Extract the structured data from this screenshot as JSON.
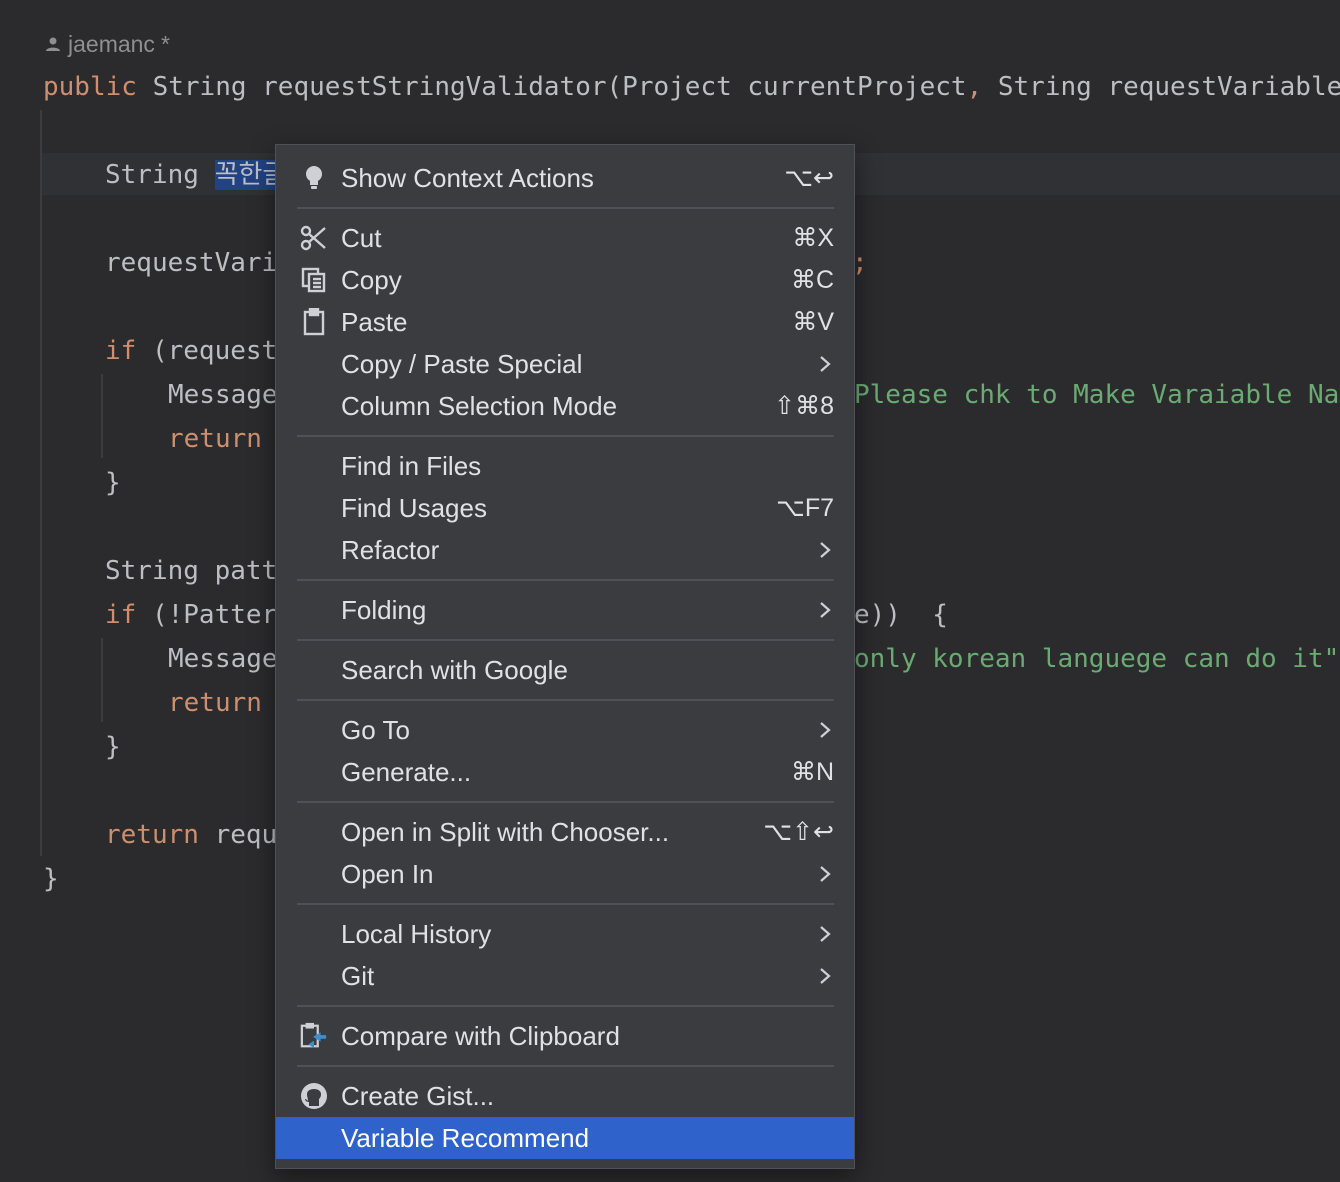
{
  "author": {
    "name": "jaemanc",
    "modified": "*"
  },
  "code": {
    "l1": {
      "kw": "public",
      "rest": " String requestStringValidator(Project currentProject",
      "comma": ",",
      "rest2": " String requestVariable"
    },
    "l2": {
      "type": "String ",
      "sel": "꼭한글"
    },
    "l3": {
      "text": "requestVari",
      "tail": ";"
    },
    "l4": {
      "kw": "if",
      "text": " (request"
    },
    "l5": {
      "text": "Message",
      "tail": "Please chk to Make Varaiable Na"
    },
    "l6": {
      "kw": "return"
    },
    "l7": {
      "text": "}"
    },
    "l8": {
      "text": "String patt"
    },
    "l9": {
      "kw": "if",
      "text": " (!Patter",
      "tail": "e))  {"
    },
    "l10": {
      "text": "Message",
      "tail": "only korean languege can do it\""
    },
    "l11": {
      "kw": "return"
    },
    "l12": {
      "text": "}"
    },
    "l13": {
      "kw": "return",
      "text": " requ"
    },
    "l14": {
      "text": "}"
    }
  },
  "menu": {
    "items": [
      {
        "label": "Show Context Actions",
        "shortcut": "⌥↩",
        "icon": "lightbulb-icon"
      },
      {
        "label": "Cut",
        "shortcut": "⌘X",
        "icon": "scissors-icon"
      },
      {
        "label": "Copy",
        "shortcut": "⌘C",
        "icon": "copy-icon"
      },
      {
        "label": "Paste",
        "shortcut": "⌘V",
        "icon": "clipboard-icon"
      },
      {
        "label": "Copy / Paste Special",
        "submenu": true
      },
      {
        "label": "Column Selection Mode",
        "shortcut": "⇧⌘8"
      },
      {
        "label": "Find in Files"
      },
      {
        "label": "Find Usages",
        "shortcut": "⌥F7"
      },
      {
        "label": "Refactor",
        "submenu": true
      },
      {
        "label": "Folding",
        "submenu": true
      },
      {
        "label": "Search with Google"
      },
      {
        "label": "Go To",
        "submenu": true
      },
      {
        "label": "Generate...",
        "shortcut": "⌘N"
      },
      {
        "label": "Open in Split with Chooser...",
        "shortcut": "⌥⇧↩"
      },
      {
        "label": "Open In",
        "submenu": true
      },
      {
        "label": "Local History",
        "submenu": true
      },
      {
        "label": "Git",
        "submenu": true
      },
      {
        "label": "Compare with Clipboard",
        "icon": "compare-clipboard-icon"
      },
      {
        "label": "Create Gist...",
        "icon": "github-icon"
      },
      {
        "label": "Variable Recommend",
        "highlighted": true
      }
    ]
  },
  "colors": {
    "editor_bg": "#2b2b2d",
    "keyword": "#cf8e6d",
    "string": "#6aab73",
    "selection": "#214283",
    "menu_bg": "#3a3c40",
    "menu_highlight": "#2f62cb"
  }
}
